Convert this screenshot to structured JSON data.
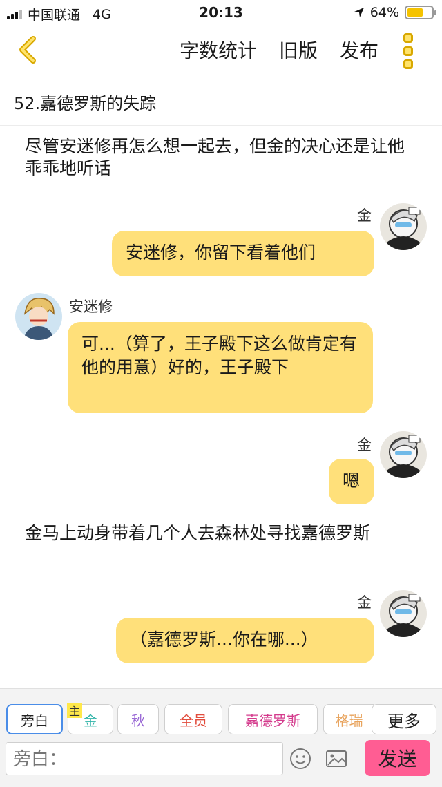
{
  "status_bar": {
    "carrier": "中国联通",
    "network": "4G",
    "time": "20:13",
    "battery": "64%",
    "battery_level": 0.64
  },
  "header": {
    "word_count": "字数统计",
    "old_version": "旧版",
    "publish": "发布"
  },
  "chapter_title": "52.嘉德罗斯的失踪",
  "messages": [
    {
      "type": "narration",
      "text": "尽管安迷修再怎么想一起去，但金的决心还是让他乖乖地听话"
    },
    {
      "type": "right",
      "name": "金",
      "text": "安迷修，你留下看着他们"
    },
    {
      "type": "left",
      "name": "安迷修",
      "text": "可...（算了，王子殿下这么做肯定有他的用意）好的，王子殿下"
    },
    {
      "type": "right",
      "name": "金",
      "text": "嗯"
    },
    {
      "type": "narration",
      "text": "金马上动身带着几个人去森林处寻找嘉德罗斯"
    },
    {
      "type": "right",
      "name": "金",
      "text": "（嘉德罗斯...你在哪...）"
    }
  ],
  "roles": {
    "host_tag": "主",
    "items": [
      {
        "label": "旁白",
        "color": "#222222"
      },
      {
        "label": "金",
        "color": "#2fb3a8"
      },
      {
        "label": "秋",
        "color": "#9b6bd6"
      },
      {
        "label": "全员",
        "color": "#e24c3c"
      },
      {
        "label": "嘉德罗斯",
        "color": "#d43a8c"
      },
      {
        "label": "格瑞",
        "color": "#e8a35c"
      },
      {
        "label": "更多",
        "color": "#222222"
      }
    ]
  },
  "composer": {
    "placeholder": "旁白：",
    "send": "发送"
  },
  "colors": {
    "bubble": "#ffe07a",
    "accent": "#f5c300",
    "send_button": "#ff5d93",
    "active_role_border": "#4a8de8"
  }
}
